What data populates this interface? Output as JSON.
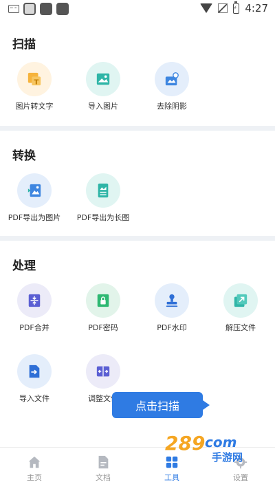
{
  "status_bar": {
    "time": "4:27"
  },
  "sections": {
    "scan": {
      "title": "扫描",
      "items": [
        {
          "label": "图片转文字",
          "icon": "image-to-text-icon"
        },
        {
          "label": "导入图片",
          "icon": "import-image-icon"
        },
        {
          "label": "去除阴影",
          "icon": "remove-shadow-icon"
        }
      ]
    },
    "convert": {
      "title": "转换",
      "items": [
        {
          "label": "PDF导出为图片",
          "icon": "pdf-to-image-icon"
        },
        {
          "label": "PDF导出为长图",
          "icon": "pdf-to-long-image-icon"
        }
      ]
    },
    "process": {
      "title": "处理",
      "items": [
        {
          "label": "PDF合并",
          "icon": "pdf-merge-icon"
        },
        {
          "label": "PDF密码",
          "icon": "pdf-lock-icon"
        },
        {
          "label": "PDF水印",
          "icon": "pdf-stamp-icon"
        },
        {
          "label": "解压文件",
          "icon": "unzip-icon"
        },
        {
          "label": "导入文件",
          "icon": "import-file-icon"
        },
        {
          "label": "调整文件",
          "icon": "adjust-file-icon"
        }
      ]
    }
  },
  "tooltip": {
    "text": "点击扫描"
  },
  "tabs": [
    {
      "label": "主页",
      "icon": "home-icon",
      "active": false
    },
    {
      "label": "文档",
      "icon": "document-icon",
      "active": false
    },
    {
      "label": "工具",
      "icon": "tools-icon",
      "active": true
    },
    {
      "label": "设置",
      "icon": "settings-icon",
      "active": false
    }
  ],
  "watermark": {
    "text": "289com 手游网"
  },
  "colors": {
    "accent": "#2f7be3",
    "divider": "#eef1f5"
  }
}
